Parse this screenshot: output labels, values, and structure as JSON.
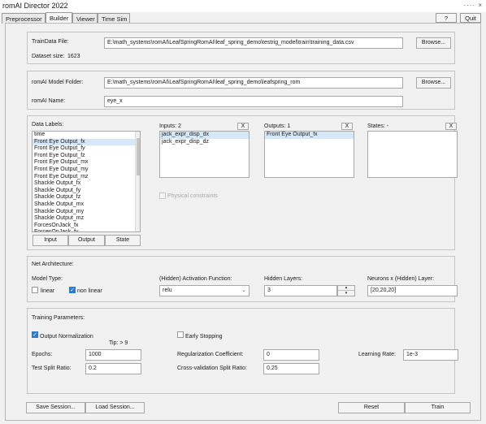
{
  "window": {
    "title": "romAI Director 2022",
    "controls": "···· ×"
  },
  "tabs": [
    "Preprocessor",
    "Builder",
    "Viewer",
    "Time Sim"
  ],
  "top_buttons": {
    "help": "?",
    "quit": "Quit"
  },
  "traindata": {
    "label": "TrainData File:",
    "value": "E:\\math_systems\\romAI\\LeafSpringRomAI\\leaf_spring_demo\\testrig_model\\train\\training_data.csv",
    "browse": "Browse...",
    "size_label": "Dataset size:",
    "size_value": "1623"
  },
  "model": {
    "folder_label": "romAI Model Folder:",
    "folder_value": "E:\\math_systems\\romAI\\LeafSpringRomAI\\leaf_spring_demo\\leafspring_rom",
    "browse": "Browse...",
    "name_label": "romAI Name:",
    "name_value": "eye_x"
  },
  "data_labels": {
    "title": "Data Labels:",
    "items": [
      "time",
      "Front Eye Output_fx",
      "Front Eye Output_fy",
      "Front Eye Output_fz",
      "Front Eye Output_mx",
      "Front Eye Output_my",
      "Front Eye Output_mz",
      "Shackle Output_fx",
      "Shackle Output_fy",
      "Shackle Output_fz",
      "Shackle Output_mx",
      "Shackle Output_my",
      "Shackle Output_mz",
      "ForcesOnJack_fx",
      "ForcesOnJack_fy"
    ],
    "buttons": [
      "Input",
      "Output",
      "State"
    ]
  },
  "inputs": {
    "title": "Inputs: 2",
    "x": "X",
    "items": [
      "jack_expr_disp_dx",
      "jack_expr_disp_dz"
    ]
  },
  "outputs": {
    "title": "Outputs: 1",
    "x": "X",
    "items": [
      "Front Eye Output_fx"
    ]
  },
  "states": {
    "title": "States: -",
    "x": "X",
    "items": []
  },
  "physical_constraints": {
    "label": "Physical constraints",
    "checked": false,
    "enabled": false
  },
  "net": {
    "title": "Net Architecture:",
    "model_type_label": "Model Type:",
    "linear_label": "linear",
    "nonlinear_label": "non linear",
    "nonlinear_checked": true,
    "activation_label": "(Hidden) Activation Function:",
    "activation_value": "relu",
    "hidden_layers_label": "Hidden Layers:",
    "hidden_layers_value": "3",
    "neurons_label": "Neurons x (Hidden) Layer:",
    "neurons_value": "[20,20,20]"
  },
  "training": {
    "title": "Training Parameters:",
    "output_norm_label": "Output Normalization",
    "output_norm_checked": true,
    "tip": "Tip: > 9",
    "early_stopping_label": "Early Stopping",
    "early_stopping_checked": false,
    "epochs_label": "Epochs:",
    "epochs_value": "1000",
    "reg_label": "Regularization Coefficient:",
    "reg_value": "0",
    "lr_label": "Learning Rate:",
    "lr_value": "1e-3",
    "test_split_label": "Test Split Ratio:",
    "test_split_value": "0.2",
    "cv_label": "Cross-validation Split Ratio:",
    "cv_value": "0.25"
  },
  "bottom": {
    "save": "Save Session...",
    "load": "Load Session...",
    "reset": "Reset",
    "train": "Train"
  },
  "icons": {
    "dropdown": "chevron-down-icon",
    "spin_up": "spin-up-icon",
    "spin_down": "spin-down-icon",
    "check": "checkmark-icon"
  },
  "colors": {
    "selection": "#d6e8f8",
    "checkbox_on": "#2a7ad1"
  }
}
